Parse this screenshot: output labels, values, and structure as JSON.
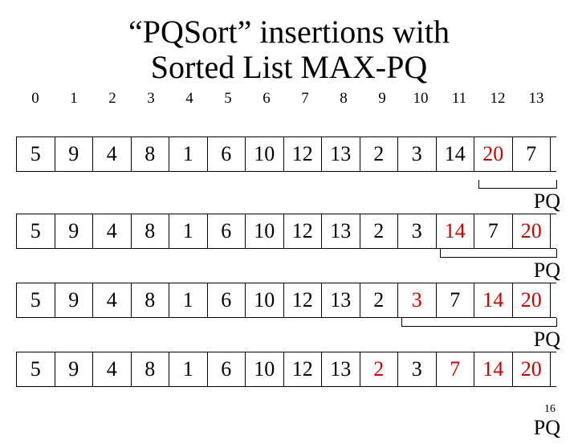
{
  "title_line1": "“PQSort” insertions with",
  "title_line2": "Sorted List MAX-PQ",
  "indices": [
    "0",
    "1",
    "2",
    "3",
    "4",
    "5",
    "6",
    "7",
    "8",
    "9",
    "10",
    "11",
    "12",
    "13"
  ],
  "rows": [
    {
      "cells": [
        "5",
        "9",
        "4",
        "8",
        "1",
        "6",
        "10",
        "12",
        "13",
        "2",
        "3",
        "14",
        "20",
        "7"
      ],
      "red": [
        12
      ]
    },
    {
      "cells": [
        "5",
        "9",
        "4",
        "8",
        "1",
        "6",
        "10",
        "12",
        "13",
        "2",
        "3",
        "14",
        "7",
        "20"
      ],
      "red": [
        11,
        13
      ]
    },
    {
      "cells": [
        "5",
        "9",
        "4",
        "8",
        "1",
        "6",
        "10",
        "12",
        "13",
        "2",
        "3",
        "7",
        "14",
        "20"
      ],
      "red": [
        10,
        12,
        13
      ]
    },
    {
      "cells": [
        "5",
        "9",
        "4",
        "8",
        "1",
        "6",
        "10",
        "12",
        "13",
        "2",
        "3",
        "7",
        "14",
        "20"
      ],
      "red": [
        9,
        11,
        12,
        13
      ]
    }
  ],
  "pq_label": "PQ",
  "page_number": "16",
  "chart_data": {
    "type": "table",
    "description": "Four successive states of an array during PQSort insertions into a sorted-list MAX priority queue. Red cells indicate the current PQ (sorted tail).",
    "column_indices": [
      0,
      1,
      2,
      3,
      4,
      5,
      6,
      7,
      8,
      9,
      10,
      11,
      12,
      13
    ],
    "states": [
      {
        "array": [
          5,
          9,
          4,
          8,
          1,
          6,
          10,
          12,
          13,
          2,
          3,
          14,
          20,
          7
        ],
        "pq_indices": [
          12
        ]
      },
      {
        "array": [
          5,
          9,
          4,
          8,
          1,
          6,
          10,
          12,
          13,
          2,
          3,
          14,
          7,
          20
        ],
        "pq_indices": [
          11,
          13
        ]
      },
      {
        "array": [
          5,
          9,
          4,
          8,
          1,
          6,
          10,
          12,
          13,
          2,
          3,
          7,
          14,
          20
        ],
        "pq_indices": [
          10,
          12,
          13
        ]
      },
      {
        "array": [
          5,
          9,
          4,
          8,
          1,
          6,
          10,
          12,
          13,
          2,
          3,
          7,
          14,
          20
        ],
        "pq_indices": [
          9,
          11,
          12,
          13
        ]
      }
    ]
  }
}
